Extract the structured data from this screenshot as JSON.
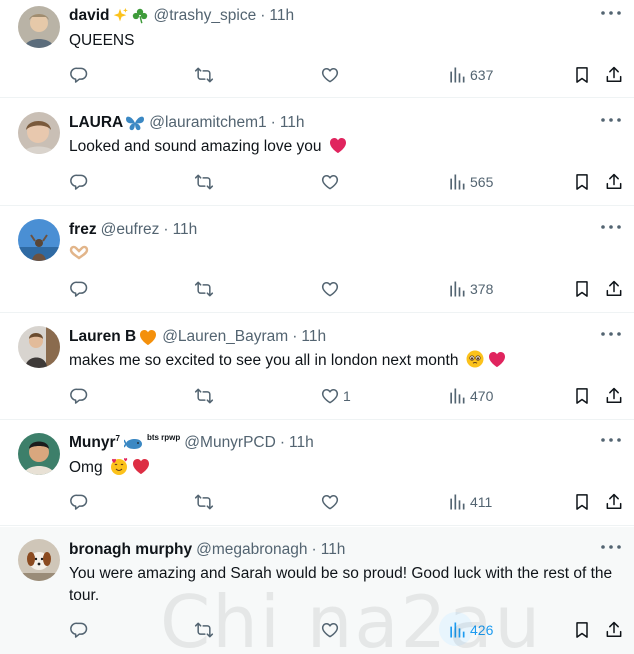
{
  "tweets": [
    {
      "name": "david",
      "handle": "@trashy_spice",
      "time": "11h",
      "text": "QUEENS",
      "replies": "",
      "retweets": "",
      "likes": "",
      "views": "637"
    },
    {
      "name": "LAURA",
      "handle": "@lauramitchem1",
      "time": "11h",
      "text": "Looked and sound amazing love you",
      "replies": "",
      "retweets": "",
      "likes": "",
      "views": "565"
    },
    {
      "name": "frez",
      "handle": "@eufrez",
      "time": "11h",
      "text": "",
      "replies": "",
      "retweets": "",
      "likes": "",
      "views": "378"
    },
    {
      "name": "Lauren B",
      "handle": "@Lauren_Bayram",
      "time": "11h",
      "text": "makes me so excited to see you all in london next month",
      "replies": "",
      "retweets": "",
      "likes": "1",
      "views": "470"
    },
    {
      "name": "Munyr",
      "name_sup": "7",
      "name_tiny": "bts rpwp",
      "handle": "@MunyrPCD",
      "time": "11h",
      "text": "Omg",
      "replies": "",
      "retweets": "",
      "likes": "",
      "views": "411"
    },
    {
      "name": "bronagh murphy",
      "handle": "@megabronagh",
      "time": "11h",
      "text": "You were amazing and Sarah would be so proud! Good luck with the rest of the tour.",
      "replies": "",
      "retweets": "",
      "likes": "",
      "views": "426"
    }
  ],
  "separator": "·",
  "watermark": "Chi na2au",
  "colors": {
    "text": "#0f1419",
    "secondary": "#536471",
    "accent": "#1d9bf0",
    "heart": "#f91880",
    "hover_bg": "#f7f9f9",
    "divider": "#eff3f4"
  },
  "icons": {
    "reply": "reply-icon",
    "retweet": "retweet-icon",
    "like": "heart-icon",
    "views": "views-icon",
    "bookmark": "bookmark-icon",
    "share": "share-icon",
    "more": "more-icon"
  }
}
